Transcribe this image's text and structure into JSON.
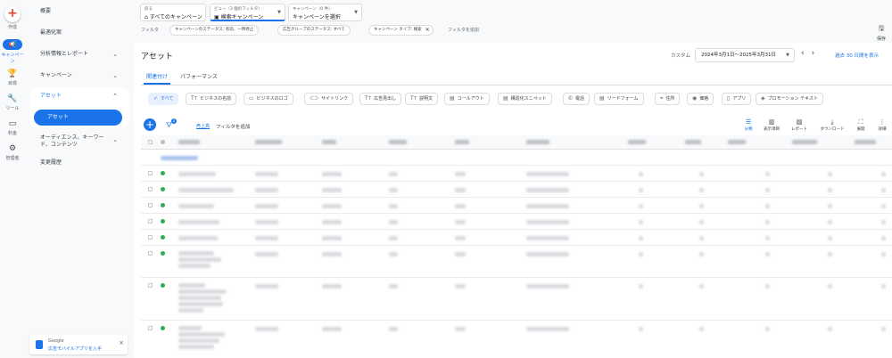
{
  "rail": {
    "create": "作成",
    "campaigns": "キャンペーン",
    "goals": "目標",
    "tools": "ツール",
    "billing": "料金",
    "admin": "管理者"
  },
  "nav": {
    "overview": "概要",
    "recommendations": "最適化案",
    "insights": "分析情報とレポート",
    "campaigns": "キャンペーン",
    "assets": "アセット",
    "assets_sub": "アセット",
    "audiences": "オーディエンス、キーワード、コンテンツ",
    "history": "変更履歴"
  },
  "promo": {
    "brand": "Google",
    "text": "広告モバイルアプリを入手"
  },
  "header": {
    "back_label": "戻る",
    "back_value": "すべてのキャンペーン",
    "view_label": "ビュー（3 個のフィルタ）",
    "view_value": "検索キャンペーン",
    "campaign_label": "キャンペーン（0 件）",
    "campaign_value": "キャンペーンを選択",
    "filter_label": "フィルタ",
    "chips": [
      "キャンペーンのステータス: 有効、一時停止",
      "広告グループのステータス: すべて",
      "キャンペーン タイプ: 検索"
    ],
    "add_filter": "フィルタを追加",
    "save": "保存"
  },
  "page": {
    "title": "アセット",
    "custom": "カスタム",
    "date_range": "2024年3月1日～2025年3月31日",
    "last30": "過去 30 日間を表示"
  },
  "tabs": [
    "関連付け",
    "パフォーマンス"
  ],
  "type_chips": [
    {
      "label": "すべて",
      "icon": "check-icon"
    },
    {
      "label": "ビジネスの名前",
      "icon": "text-icon"
    },
    {
      "label": "ビジネスのロゴ",
      "icon": "image-icon"
    },
    {
      "label": "サイトリンク",
      "icon": "link-icon"
    },
    {
      "label": "広告見出し",
      "icon": "text-icon"
    },
    {
      "label": "説明文",
      "icon": "text-icon"
    },
    {
      "label": "コールアウト",
      "icon": "callout-icon"
    },
    {
      "label": "構造化スニペット",
      "icon": "snippet-icon"
    },
    {
      "label": "電話",
      "icon": "phone-icon"
    },
    {
      "label": "リードフォーム",
      "icon": "form-icon"
    },
    {
      "label": "住所",
      "icon": "pin-icon"
    },
    {
      "label": "価格",
      "icon": "price-icon"
    },
    {
      "label": "アプリ",
      "icon": "app-icon"
    },
    {
      "label": "プロモーション テキスト",
      "icon": "promo-icon"
    }
  ],
  "toolbar": {
    "filter_status": "売上高",
    "add_filter": "フィルタを追加",
    "filter_count": "2",
    "segment": "分類",
    "columns": "表示項目",
    "reports": "レポート",
    "download": "ダウンロード",
    "expand": "展開",
    "more": "詳細"
  }
}
